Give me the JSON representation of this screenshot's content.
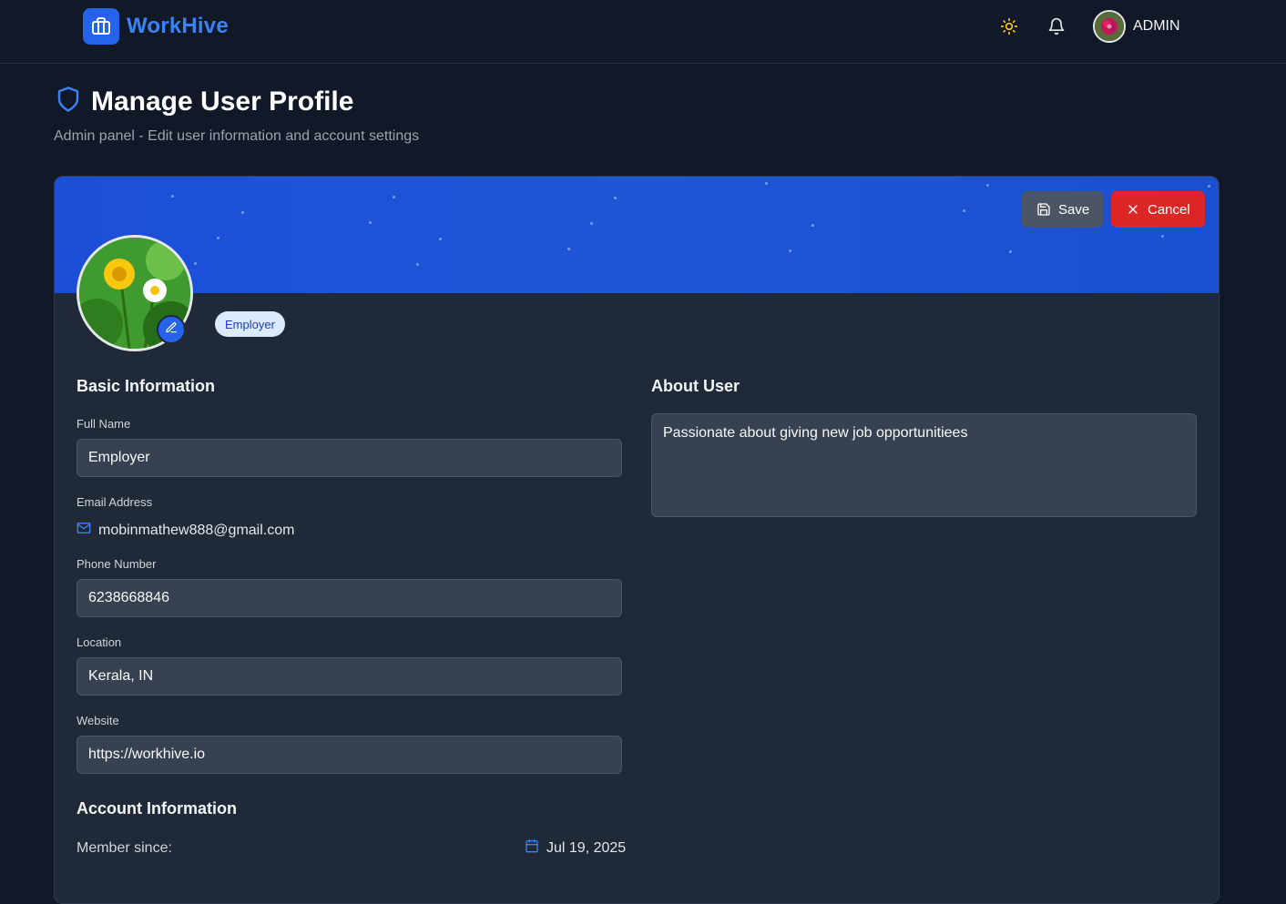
{
  "brand": {
    "name": "WorkHive",
    "color": "#2563eb"
  },
  "nav": {
    "user_label": "ADMIN",
    "theme_icon": "sun-icon",
    "notify_icon": "bell-icon"
  },
  "page": {
    "title": "Manage User Profile",
    "subtitle": "Admin panel - Edit user information and account settings"
  },
  "actions": {
    "save_label": "Save",
    "cancel_label": "Cancel"
  },
  "profile": {
    "role_badge": "Employer"
  },
  "basic": {
    "title": "Basic Information",
    "full_name_label": "Full Name",
    "full_name": "Employer",
    "email_label": "Email Address",
    "email": "mobinmathew888@gmail.com",
    "phone_label": "Phone Number",
    "phone": "6238668846",
    "location_label": "Location",
    "location": "Kerala, IN",
    "website_label": "Website",
    "website": "https://workhive.io"
  },
  "about": {
    "title": "About User",
    "text": "Passionate about giving new job opportunitiees"
  },
  "account": {
    "title": "Account Information",
    "member_since_label": "Member since:",
    "member_since": "Jul 19, 2025"
  },
  "colors": {
    "accent": "#2563eb",
    "danger": "#dc2626",
    "background": "#111827",
    "card": "#1f2937"
  }
}
